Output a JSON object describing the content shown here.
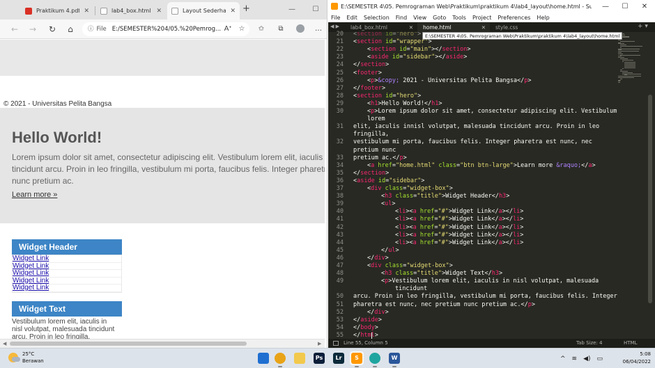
{
  "browser": {
    "tabs": [
      {
        "label": "Praktikum 4.pdf",
        "icon": "pdf-icon",
        "color": "#d93025",
        "active": false
      },
      {
        "label": "lab4_box.html",
        "icon": "document-icon",
        "color": "#9e9e9e",
        "active": false
      },
      {
        "label": "Layout Sederhana",
        "icon": "document-icon",
        "color": "#9e9e9e",
        "active": true
      }
    ],
    "new_tab_label": "+",
    "file_label": "File",
    "url": "E:/SEMESTER%204/05.%20Pemrog...",
    "page": {
      "footer_text": "© 2021 - Universitas Pelita Bangsa",
      "hero_title": "Hello World!",
      "hero_lines": [
        "Lorem ipsum dolor sit amet, consectetur adipiscing elit. Vestibulum lorem elit, iaculis innisl",
        "tincidunt arcu. Proin in leo fringilla, vestibulum mi porta, faucibus felis. Integer pharetra",
        "nunc pretium ac."
      ],
      "hero_link": "Learn more »",
      "widget1_title": "Widget Header",
      "widget1_links": [
        "Widget Link",
        "Widget Link",
        "Widget Link",
        "Widget Link",
        "Widget Link"
      ],
      "widget2_title": "Widget Text",
      "widget2_lines": [
        "Vestibulum lorem elit, iaculis in",
        "nisl volutpat, malesuada tincidunt",
        "arcu. Proin in leo fringilla,"
      ]
    }
  },
  "sublime": {
    "title": "E:\\SEMESTER 4\\05. Pemrograman Web\\Praktikum\\praktikum 4\\lab4_layout\\home.html - Sublime Text (UNREGIS...",
    "menu": [
      "File",
      "Edit",
      "Selection",
      "Find",
      "View",
      "Goto",
      "Tools",
      "Project",
      "Preferences",
      "Help"
    ],
    "tabs": [
      {
        "label": "lab4_box.html",
        "active": false
      },
      {
        "label": "home.html",
        "active": true
      },
      {
        "label": "style.css",
        "active": false
      }
    ],
    "tooltip": "E:\\SEMESTER 4\\05. Pemrograman Web\\Praktikum\\praktikum 4\\lab4_layout\\home.html",
    "code_lines": [
      {
        "n": "20",
        "t": "<section id=\"hero\">",
        "i": 0,
        "partial": true
      },
      {
        "n": "21",
        "t": "<section id=\"wrapper\">",
        "i": 0
      },
      {
        "n": "22",
        "t": "<section id=\"main\"></section>",
        "i": 1
      },
      {
        "n": "23",
        "t": "<aside id=\"sidebar\"></aside>",
        "i": 1
      },
      {
        "n": "24",
        "t": "</section>",
        "i": 0
      },
      {
        "n": "25",
        "t": "<footer>",
        "i": 0
      },
      {
        "n": "26",
        "t": "<p>&copy; 2021 - Universitas Pelita Bangsa</p>",
        "i": 1
      },
      {
        "n": "27",
        "t": "</footer>",
        "i": 0
      },
      {
        "n": "28",
        "t": "<section id=\"hero\">",
        "i": 0
      },
      {
        "n": "29",
        "t": "<h1>Hello World!</h1>",
        "i": 1
      },
      {
        "n": "30",
        "t": "<p>Lorem ipsum dolor sit amet, consectetur adipiscing elit. Vestibulum",
        "i": 1
      },
      {
        "n": "",
        "t": "lorem",
        "i": 1
      },
      {
        "n": "31",
        "t": "elit, iaculis innisl volutpat, malesuada tincidunt arcu. Proin in leo",
        "i": 0
      },
      {
        "n": "",
        "t": "fringilla,",
        "i": 0
      },
      {
        "n": "32",
        "t": "vestibulum mi porta, faucibus felis. Integer pharetra est nunc, nec",
        "i": 0
      },
      {
        "n": "",
        "t": "pretium nunc",
        "i": 0
      },
      {
        "n": "33",
        "t": "pretium ac.</p>",
        "i": 0
      },
      {
        "n": "34",
        "t": "<a href=\"home.html\" class=\"btn btn-large\">Learn more &raquo;</a>",
        "i": 1
      },
      {
        "n": "35",
        "t": "</section>",
        "i": 0
      },
      {
        "n": "36",
        "t": "<aside id=\"sidebar\">",
        "i": 0
      },
      {
        "n": "37",
        "t": "<div class=\"widget-box\">",
        "i": 1
      },
      {
        "n": "38",
        "t": "<h3 class=\"title\">Widget Header</h3>",
        "i": 2
      },
      {
        "n": "39",
        "t": "<ul>",
        "i": 2
      },
      {
        "n": "40",
        "t": "<li><a href=\"#\">Widget Link</a></li>",
        "i": 3
      },
      {
        "n": "41",
        "t": "<li><a href=\"#\">Widget Link</a></li>",
        "i": 3
      },
      {
        "n": "42",
        "t": "<li><a href=\"#\">Widget Link</a></li>",
        "i": 3
      },
      {
        "n": "43",
        "t": "<li><a href=\"#\">Widget Link</a></li>",
        "i": 3
      },
      {
        "n": "44",
        "t": "<li><a href=\"#\">Widget Link</a></li>",
        "i": 3
      },
      {
        "n": "45",
        "t": "</ul>",
        "i": 2
      },
      {
        "n": "46",
        "t": "</div>",
        "i": 1
      },
      {
        "n": "47",
        "t": "<div class=\"widget-box\">",
        "i": 1
      },
      {
        "n": "48",
        "t": "<h3 class=\"title\">Widget Text</h3>",
        "i": 2
      },
      {
        "n": "49",
        "t": "<p>Vestibulum lorem elit, iaculis in nisl volutpat, malesuada",
        "i": 2
      },
      {
        "n": "",
        "t": "tincidunt",
        "i": 3
      },
      {
        "n": "50",
        "t": "arcu. Proin in leo fringilla, vestibulum mi porta, faucibus felis. Integer",
        "i": 0
      },
      {
        "n": "51",
        "t": "pharetra est nunc, nec pretium nunc pretium ac.</p>",
        "i": 0
      },
      {
        "n": "52",
        "t": "</div>",
        "i": 1
      },
      {
        "n": "53",
        "t": "</aside>",
        "i": 0
      },
      {
        "n": "54",
        "t": "</body>",
        "i": 0
      },
      {
        "n": "55",
        "t": "</html>",
        "i": 0
      }
    ],
    "status_left": "Line 55, Column 5",
    "tab_size": "Tab Size: 4",
    "syntax": "HTML"
  },
  "taskbar": {
    "temp": "25°C",
    "weather": "Berawan",
    "apps": [
      {
        "name": "start-icon",
        "label": "",
        "color": "#1f6fd1"
      },
      {
        "name": "chrome-icon",
        "label": "",
        "color": "#e8a317"
      },
      {
        "name": "file-explorer-icon",
        "label": "",
        "color": "#f2c94c"
      },
      {
        "name": "photoshop-icon",
        "label": "Ps",
        "color": "#0b1f3a"
      },
      {
        "name": "lightroom-icon",
        "label": "Lr",
        "color": "#0b2a3a"
      },
      {
        "name": "sublime-text-icon",
        "label": "S",
        "color": "#ff9800"
      },
      {
        "name": "edge-icon",
        "label": "",
        "color": "#1fa5a0"
      },
      {
        "name": "word-icon",
        "label": "W",
        "color": "#2b579a"
      }
    ],
    "time": "5:08",
    "date": "06/04/2022"
  }
}
